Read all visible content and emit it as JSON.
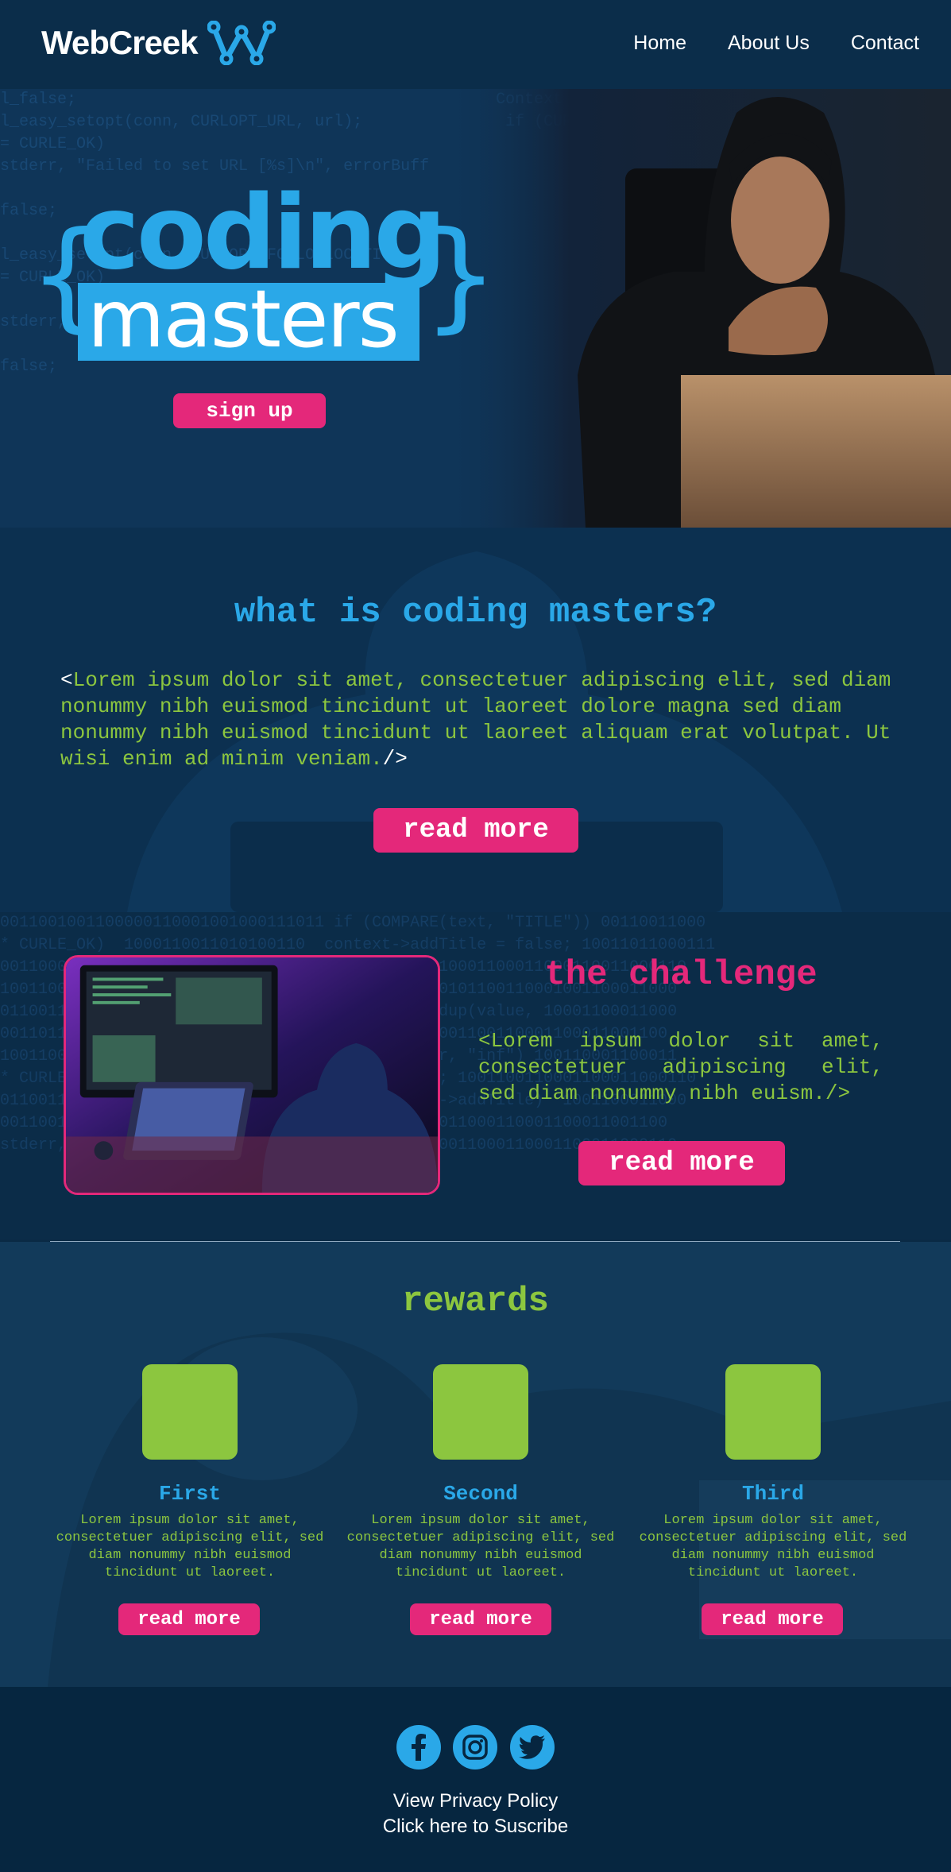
{
  "header": {
    "logo_text": "WebCreek",
    "nav": [
      "Home",
      "About Us",
      "Contact"
    ]
  },
  "hero": {
    "title_line1": "coding",
    "title_line2": "masters",
    "brace_open": "{",
    "brace_close": "}",
    "signup_label": "sign up"
  },
  "about": {
    "title": "what is coding masters?",
    "open_tag": "<",
    "body": "Lorem ipsum dolor sit amet, consectetuer adipiscing elit, sed diam nonummy nibh euismod tincidunt ut laoreet dolore magna sed diam nonummy nibh euismod tincidunt ut laoreet aliquam erat volutpat. Ut wisi enim ad minim veniam.",
    "close_tag": "/>",
    "button_label": "read more"
  },
  "challenge": {
    "title": "the challenge",
    "open_tag": "<",
    "body": "Lorem ipsum dolor sit amet, consectetuer adipiscing elit, sed diam nonummy nibh euism.",
    "close_tag": "/>",
    "button_label": "read more"
  },
  "rewards": {
    "title": "rewards",
    "items": [
      {
        "title": "First",
        "desc": "Lorem ipsum dolor sit amet, consectetuer adipiscing elit, sed diam nonummy nibh euismod tincidunt ut laoreet.",
        "button_label": "read more"
      },
      {
        "title": "Second",
        "desc": "Lorem ipsum dolor sit amet, consectetuer adipiscing elit, sed diam nonummy nibh euismod tincidunt ut laoreet.",
        "button_label": "read more"
      },
      {
        "title": "Third",
        "desc": "Lorem ipsum dolor sit amet, consectetuer adipiscing elit, sed diam nonummy nibh euismod tincidunt ut laoreet.",
        "button_label": "read more"
      }
    ]
  },
  "footer": {
    "social_icons": [
      "facebook-icon",
      "instagram-icon",
      "twitter-icon"
    ],
    "privacy_link": "View Privacy Policy",
    "subscribe_link": "Click here to Suscribe"
  },
  "colors": {
    "accent_blue": "#2aa8e8",
    "accent_pink": "#e4287a",
    "accent_green": "#8cc63f",
    "background": "#0a2a45"
  }
}
